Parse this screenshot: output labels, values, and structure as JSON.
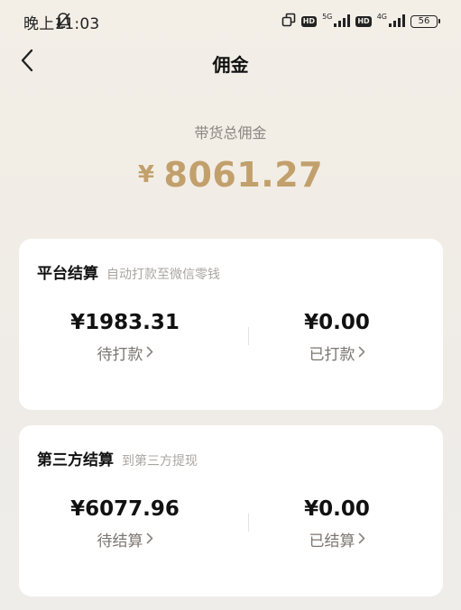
{
  "status_bar": {
    "time": "晚上11:03",
    "network_1": "5G",
    "network_2": "4G",
    "hd": "HD",
    "battery": "56"
  },
  "nav": {
    "title": "佣金",
    "back_icon": "chevron-left-icon"
  },
  "summary": {
    "label": "带货总佣金",
    "currency": "¥",
    "amount": "8061.27",
    "accent_color": "#c2a06c"
  },
  "platform_card": {
    "title": "平台结算",
    "subtitle": "自动打款至微信零钱",
    "pending_value": "¥1983.31",
    "pending_label": "待打款",
    "done_value": "¥0.00",
    "done_label": "已打款"
  },
  "third_party_card": {
    "title": "第三方结算",
    "subtitle": "到第三方提现",
    "pending_value": "¥6077.96",
    "pending_label": "待结算",
    "done_value": "¥0.00",
    "done_label": "已结算"
  }
}
